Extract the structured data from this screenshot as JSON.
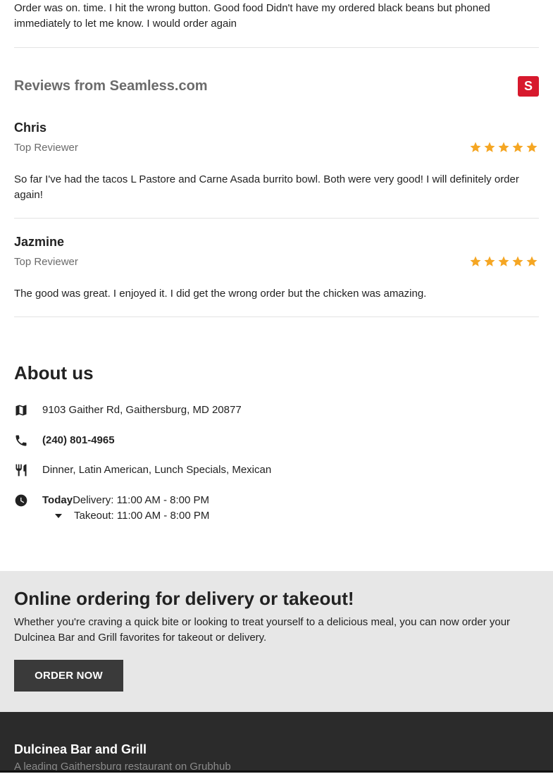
{
  "previous_review": {
    "text": "Order was on. time. I hit the wrong button. Good food Didn't have my ordered black beans but phoned immediately to let me know. I would order again"
  },
  "seamless": {
    "title": "Reviews from Seamless.com",
    "logo_letter": "S",
    "logo_color": "#d7192d",
    "reviews": [
      {
        "name": "Chris",
        "badge": "Top Reviewer",
        "rating": 5,
        "text": "So far I've had the tacos L Pastore and Carne Asada burrito bowl. Both were very good! I will definitely order again!"
      },
      {
        "name": "Jazmine",
        "badge": "Top Reviewer",
        "rating": 5,
        "text": "The good was great. I enjoyed it. I did get the wrong order but the chicken was amazing."
      }
    ],
    "star_color": "#f5a623"
  },
  "about": {
    "title": "About us",
    "address": "9103 Gaither Rd, Gaithersburg, MD 20877",
    "phone": "(240) 801-4965",
    "cuisines": "Dinner, Latin American, Lunch Specials, Mexican",
    "hours": {
      "day_label": "Today",
      "delivery": "Delivery: 11:00 AM - 8:00 PM",
      "takeout": "Takeout: 11:00 AM - 8:00 PM"
    },
    "icons": [
      "map-icon",
      "phone-icon",
      "utensils-icon",
      "clock-icon",
      "caret-down-icon"
    ]
  },
  "order": {
    "title": "Online ordering for delivery or takeout!",
    "description": "Whether you're craving a quick bite or looking to treat yourself to a delicious meal, you can now order your Dulcinea Bar and Grill favorites for takeout or delivery.",
    "button_label": "ORDER NOW"
  },
  "footer": {
    "restaurant_name": "Dulcinea Bar and Grill",
    "tagline": "A leading Gaithersburg restaurant on Grubhub"
  }
}
